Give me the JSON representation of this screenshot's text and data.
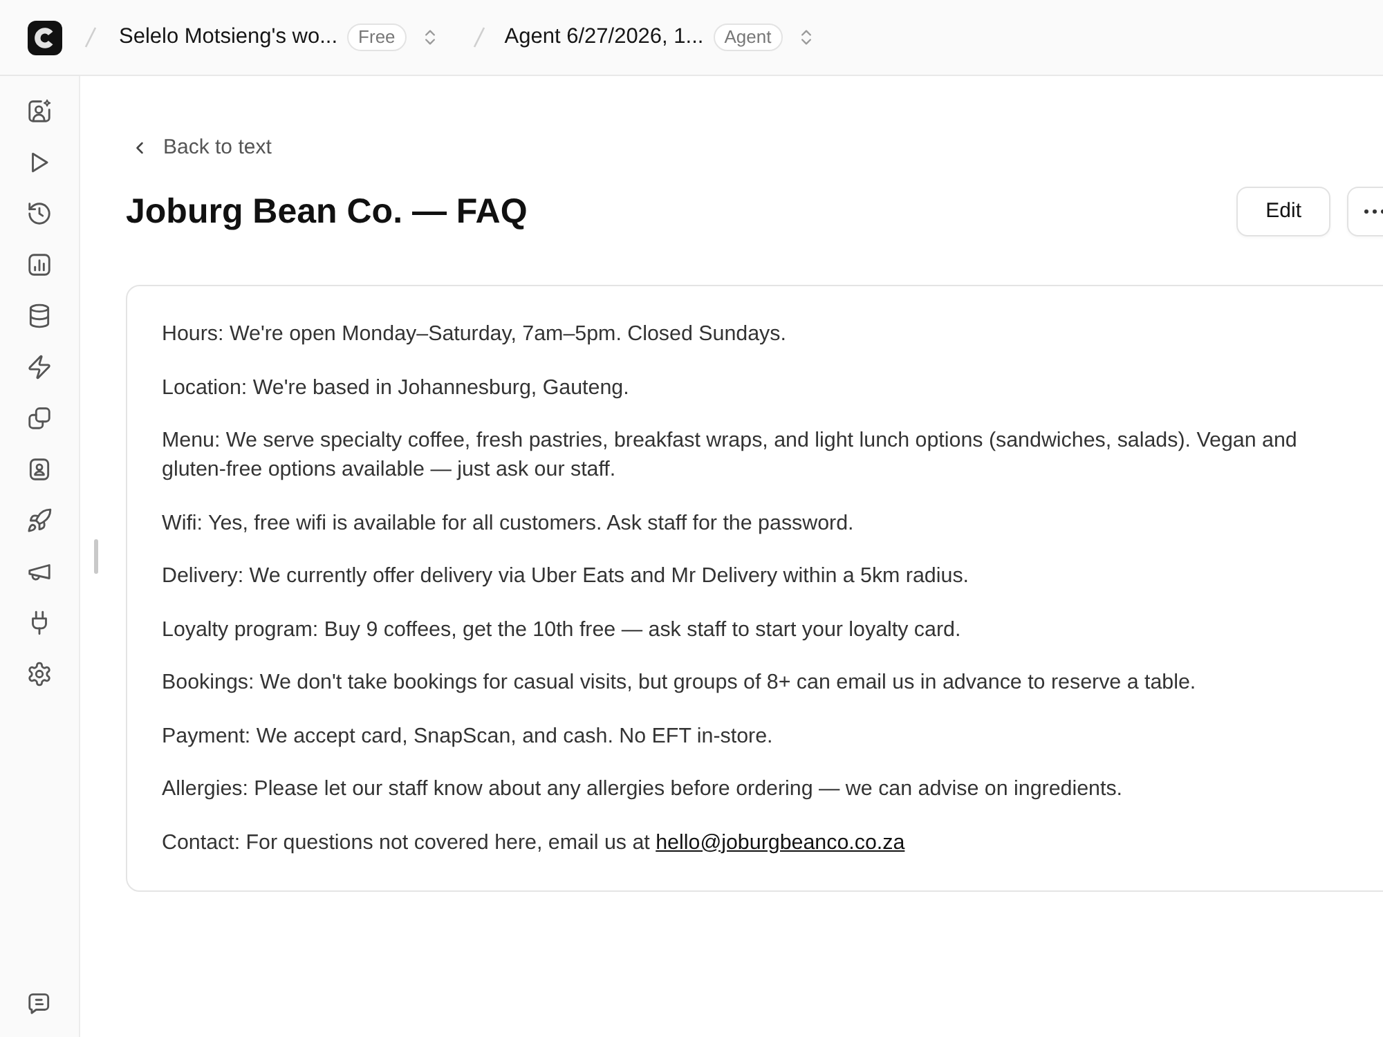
{
  "breadcrumb": [
    {
      "label": "Selelo Motsieng's wo...",
      "badge": "Free"
    },
    {
      "label": "Agent 6/27/2026, 1...",
      "badge": "Agent"
    }
  ],
  "page": {
    "back_link": "Back to text",
    "title": "Joburg Bean Co. — FAQ",
    "actions": [
      {
        "label": "Edit"
      }
    ]
  },
  "document": {
    "paragraphs": [
      {
        "text": "Hours: We're open Monday–Saturday, 7am–5pm. Closed Sundays."
      },
      {
        "text": "Location: We're based in Johannesburg, Gauteng."
      },
      {
        "text": "Menu: We serve specialty coffee, fresh pastries, breakfast wraps, and light lunch options (sandwiches, salads). Vegan and gluten-free options available — just ask our staff."
      },
      {
        "text": "Wifi: Yes, free wifi is available for all customers. Ask staff for the password."
      },
      {
        "text": "Delivery: We currently offer delivery via Uber Eats and Mr Delivery within a 5km radius."
      },
      {
        "text": "Loyalty program: Buy 9 coffees, get the 10th free — ask staff to start your loyalty card."
      },
      {
        "text": "Bookings: We don't take bookings for casual visits, but groups of 8+ can email us in advance to reserve a table."
      },
      {
        "text": "Payment: We accept card, SnapScan, and cash. No EFT in-store."
      },
      {
        "text": "Allergies: Please let our staff know about any allergies before ordering — we can advise on ingredients."
      },
      {
        "text": "Contact: For questions not covered here, email us at",
        "link": "hello@joburgbeanco.co.za"
      }
    ]
  }
}
